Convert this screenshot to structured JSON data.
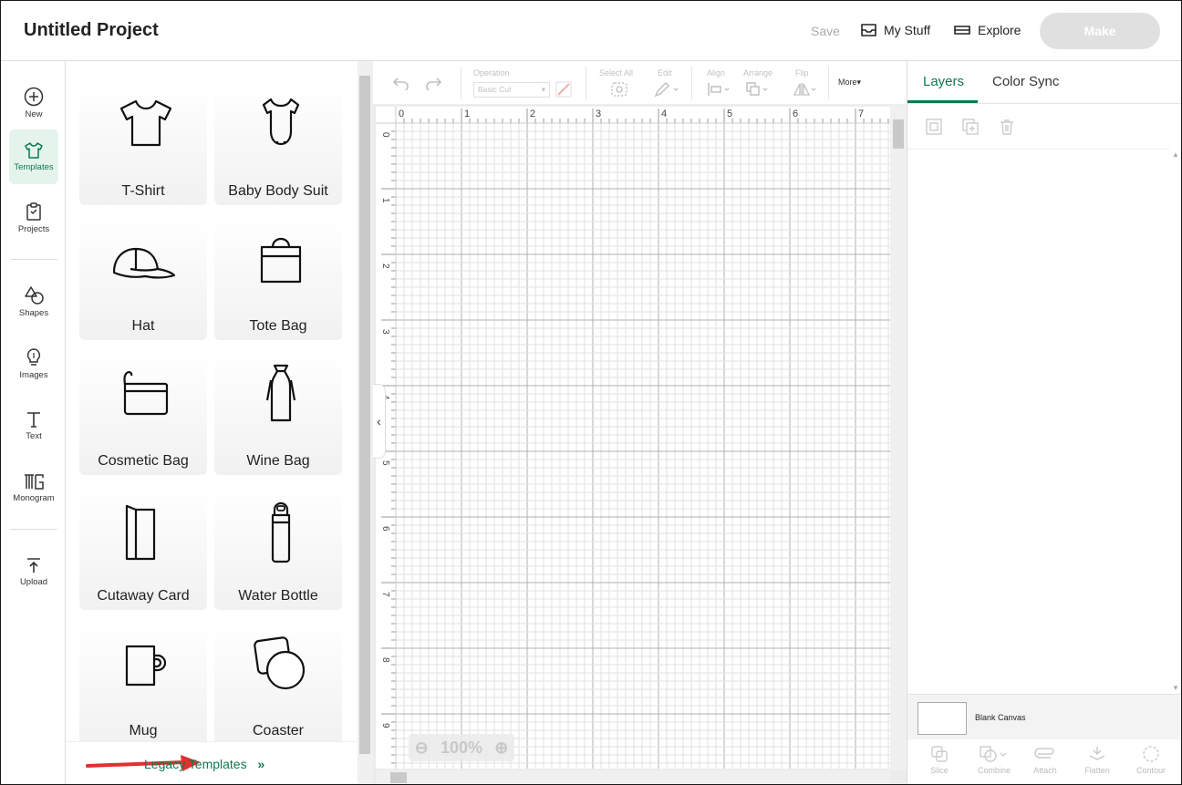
{
  "header": {
    "project_title": "Untitled Project",
    "save_label": "Save",
    "my_stuff_label": "My Stuff",
    "explore_label": "Explore",
    "make_label": "Make"
  },
  "rail": {
    "items": [
      {
        "label": "New",
        "icon": "plus-circle-icon"
      },
      {
        "label": "Templates",
        "icon": "tshirt-icon",
        "active": true
      },
      {
        "label": "Projects",
        "icon": "projects-icon"
      },
      {
        "label": "Shapes",
        "icon": "shapes-icon"
      },
      {
        "label": "Images",
        "icon": "lightbulb-icon"
      },
      {
        "label": "Text",
        "icon": "text-icon"
      },
      {
        "label": "Monogram",
        "icon": "monogram-icon"
      },
      {
        "label": "Upload",
        "icon": "upload-icon"
      }
    ]
  },
  "templates": {
    "cards": [
      {
        "label": "T-Shirt",
        "icon": "tshirt-icon"
      },
      {
        "label": "Baby Body Suit",
        "icon": "bodysuit-icon"
      },
      {
        "label": "Hat",
        "icon": "hat-icon"
      },
      {
        "label": "Tote Bag",
        "icon": "tote-bag-icon"
      },
      {
        "label": "Cosmetic Bag",
        "icon": "cosmetic-bag-icon"
      },
      {
        "label": "Wine Bag",
        "icon": "wine-bag-icon"
      },
      {
        "label": "Cutaway Card",
        "icon": "card-icon"
      },
      {
        "label": "Water Bottle",
        "icon": "water-bottle-icon"
      },
      {
        "label": "Mug",
        "icon": "mug-icon"
      },
      {
        "label": "Coaster",
        "icon": "coaster-icon"
      }
    ],
    "legacy_label": "Legacy Templates",
    "legacy_chevron": "»",
    "highlight_color": "#e03030"
  },
  "toolbar": {
    "operation_label": "Operation",
    "operation_value": "Basic Cut",
    "select_all_label": "Select All",
    "edit_label": "Edit",
    "align_label": "Align",
    "arrange_label": "Arrange",
    "flip_label": "Flip",
    "more_label": "More"
  },
  "canvas": {
    "ruler_x": [
      "0",
      "1",
      "2",
      "3",
      "4",
      "5",
      "6",
      "7"
    ],
    "ruler_y": [
      "0",
      "1",
      "2",
      "3",
      "4",
      "5",
      "6",
      "7",
      "8",
      "9"
    ],
    "zoom_value": "100%",
    "zoom_out_symbol": "⊖",
    "zoom_in_symbol": "⊕"
  },
  "right_panel": {
    "tabs": [
      {
        "label": "Layers",
        "active": true
      },
      {
        "label": "Color Sync",
        "active": false
      }
    ],
    "blank_canvas_label": "Blank Canvas",
    "bottom_tools": [
      {
        "label": "Slice",
        "icon": "slice-icon"
      },
      {
        "label": "Combine",
        "icon": "combine-icon"
      },
      {
        "label": "Attach",
        "icon": "attach-icon"
      },
      {
        "label": "Flatten",
        "icon": "flatten-icon"
      },
      {
        "label": "Contour",
        "icon": "contour-icon"
      }
    ]
  },
  "colors": {
    "accent": "#0d7a4d",
    "make_disabled": "#e0e0e0"
  }
}
